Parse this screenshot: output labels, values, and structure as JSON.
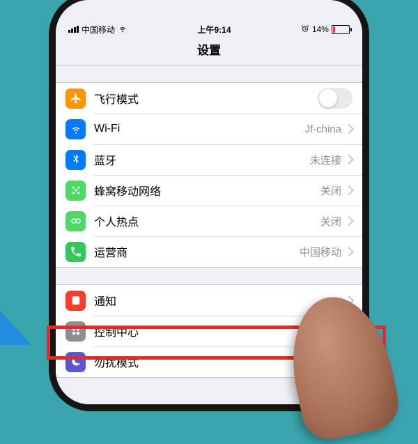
{
  "status": {
    "carrier": "中国移动",
    "time": "上午9:14",
    "battery_pct": "14%"
  },
  "title": "设置",
  "group1": [
    {
      "label": "飞行模式",
      "detail": "",
      "type": "switch"
    },
    {
      "label": "Wi-Fi",
      "detail": "Jf-china",
      "type": "link"
    },
    {
      "label": "蓝牙",
      "detail": "未连接",
      "type": "link"
    },
    {
      "label": "蜂窝移动网络",
      "detail": "关闭",
      "type": "link"
    },
    {
      "label": "个人热点",
      "detail": "关闭",
      "type": "link"
    },
    {
      "label": "运营商",
      "detail": "中国移动",
      "type": "link"
    }
  ],
  "group2": [
    {
      "label": "通知"
    },
    {
      "label": "控制中心"
    },
    {
      "label": "勿扰模式"
    }
  ]
}
